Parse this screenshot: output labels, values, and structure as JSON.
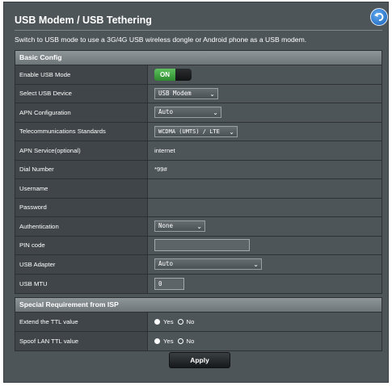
{
  "page": {
    "title": "USB Modem / USB Tethering",
    "description": "Switch to USB mode to use a 3G/4G USB wireless dongle or Android phone as a USB modem."
  },
  "basic_config": {
    "header": "Basic Config",
    "enable_usb_mode": {
      "label": "Enable USB Mode",
      "state": "ON"
    },
    "select_usb_device": {
      "label": "Select USB Device",
      "value": "USB Modem"
    },
    "apn_configuration": {
      "label": "APN Configuration",
      "value": "Auto"
    },
    "telecom_standards": {
      "label": "Telecommunications Standards",
      "value": "WCDMA (UMTS) / LTE"
    },
    "apn_service": {
      "label": "APN Service(optional)",
      "value": "internet"
    },
    "dial_number": {
      "label": "Dial Number",
      "value": "*99#"
    },
    "username": {
      "label": "Username",
      "value": ""
    },
    "password": {
      "label": "Password",
      "value": ""
    },
    "authentication": {
      "label": "Authentication",
      "value": "None"
    },
    "pin_code": {
      "label": "PIN code",
      "value": ""
    },
    "usb_adapter": {
      "label": "USB Adapter",
      "value": "Auto"
    },
    "usb_mtu": {
      "label": "USB MTU",
      "value": "0"
    }
  },
  "special_requirement": {
    "header": "Special Requirement from ISP",
    "extend_ttl": {
      "label": "Extend the TTL value",
      "yes": "Yes",
      "no": "No",
      "selected": "Yes"
    },
    "spoof_lan_ttl": {
      "label": "Spoof LAN TTL value",
      "yes": "Yes",
      "no": "No",
      "selected": "Yes"
    }
  },
  "apply_label": "Apply",
  "colors": {
    "background": "#4d5559",
    "label_column": "#3f4548",
    "toggle_on": "#2e8b2e",
    "back_button": "#1a62b8"
  }
}
